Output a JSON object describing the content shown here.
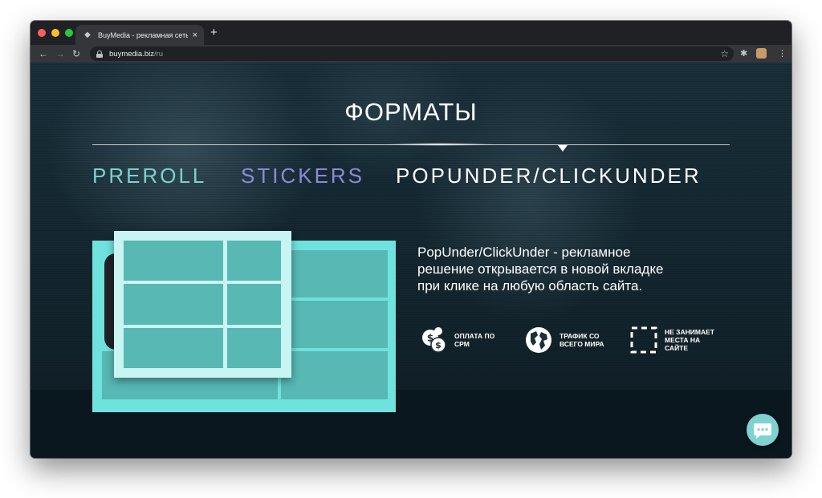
{
  "browser": {
    "tab_title": "BuyMedia - рекламная сеть д",
    "tab_close": "×",
    "new_tab": "+",
    "url_host": "buymedia.biz",
    "url_path": "/ru",
    "back": "←",
    "forward": "→",
    "reload": "↻",
    "bookmark": "☆",
    "extensions": "✱",
    "menu": "⋮"
  },
  "page": {
    "section_title": "ФОРМАТЫ",
    "tabs": [
      {
        "label": "PREROLL",
        "color": "#79d3cf"
      },
      {
        "label": "STICKERS",
        "color": "#8c8ad8"
      },
      {
        "label": "POPUNDER/CLICKUNDER",
        "color": "#ffffff",
        "active": true
      }
    ],
    "description_lines": [
      "PopUnder/ClickUnder - рекламное",
      "решение открывается в новой вкладке",
      "при клике на любую область сайта."
    ],
    "features": [
      {
        "icon": "coins-dollar-icon",
        "lines": [
          "ОПЛАТА ПО",
          "CPM"
        ]
      },
      {
        "icon": "globe-icon",
        "lines": [
          "ТРАФИК СО",
          "ВСЕГО МИРА"
        ]
      },
      {
        "icon": "dashed-frame-icon",
        "lines": [
          "НЕ ЗАНИМАЕТ",
          "МЕСТА НА",
          "САЙТЕ"
        ]
      }
    ]
  },
  "colors": {
    "accent_teal": "#70e2de",
    "cell_teal": "#57b8b4",
    "stickers_purple": "#8c8ad8",
    "page_bg": "#0e1f28",
    "chat_button": "#7ed2cf"
  },
  "icons": {
    "chat": "chat-bubble-icon",
    "tab_favicon": "buymedia-favicon-icon"
  }
}
